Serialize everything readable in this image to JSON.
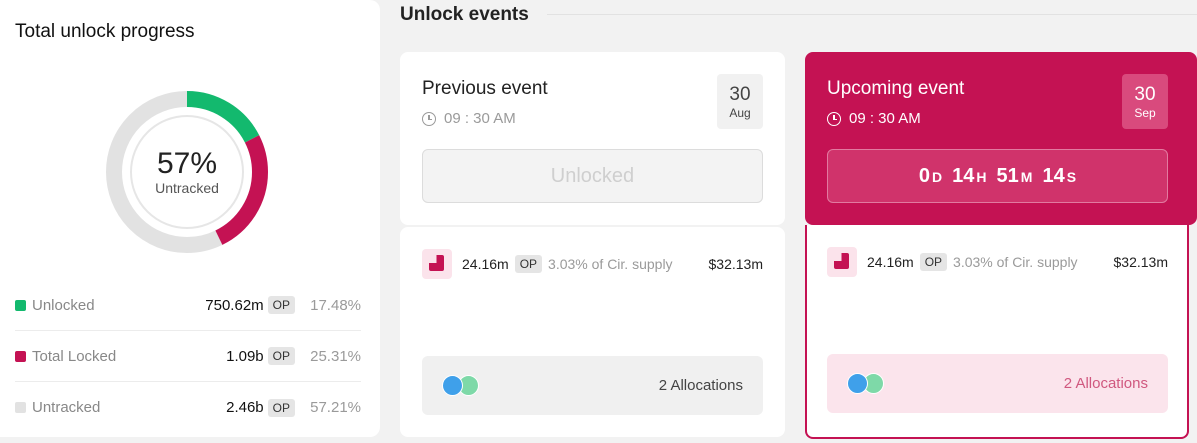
{
  "progress": {
    "title": "Total unlock progress",
    "donut": {
      "percent": "57%",
      "subtitle": "Untracked"
    },
    "segments": [
      {
        "name": "Unlocked",
        "fraction": 0.1748,
        "color": "#13b96e"
      },
      {
        "name": "Total Locked",
        "fraction": 0.2531,
        "color": "#c41253"
      },
      {
        "name": "Untracked",
        "fraction": 0.5721,
        "color": "#e2e2e2"
      }
    ],
    "legend": [
      {
        "label": "Unlocked",
        "value": "750.62m",
        "token": "OP",
        "pct": "17.48%",
        "color": "#13b96e"
      },
      {
        "label": "Total Locked",
        "value": "1.09b",
        "token": "OP",
        "pct": "25.31%",
        "color": "#c41253"
      },
      {
        "label": "Untracked",
        "value": "2.46b",
        "token": "OP",
        "pct": "57.21%",
        "color": "#e2e2e2"
      }
    ]
  },
  "events": {
    "section_title": "Unlock events",
    "previous": {
      "title": "Previous event",
      "time": "09 : 30 AM",
      "day": "30",
      "month": "Aug",
      "status": "Unlocked",
      "amount": "24.16m",
      "token": "OP",
      "supply": "3.03% of Cir. supply",
      "usd": "$32.13m",
      "allocations": "2 Allocations"
    },
    "upcoming": {
      "title": "Upcoming event",
      "time": "09 : 30 AM",
      "day": "30",
      "month": "Sep",
      "countdown": {
        "d": "0",
        "h": "14",
        "m": "51",
        "s": "14",
        "d_unit": "D",
        "h_unit": "H",
        "m_unit": "M",
        "s_unit": "S"
      },
      "amount": "24.16m",
      "token": "OP",
      "supply": "3.03% of Cir. supply",
      "usd": "$32.13m",
      "allocations": "2 Allocations"
    }
  }
}
